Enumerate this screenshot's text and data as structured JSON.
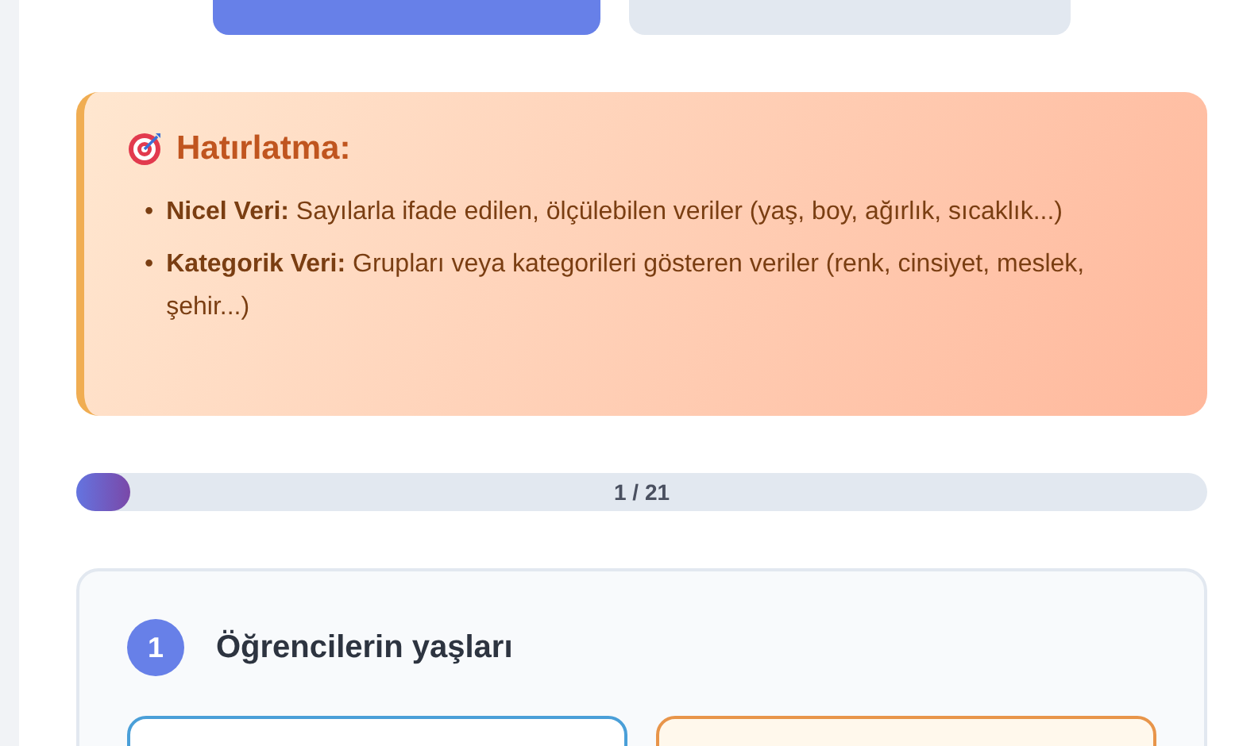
{
  "top_buttons": [
    {
      "selected": true
    },
    {
      "selected": false
    }
  ],
  "reminder": {
    "title": "Hatırlatma:",
    "items": [
      {
        "bullet": "•",
        "term": "Nicel Veri:",
        "text": "Sayılarla ifade edilen, ölçülebilen veriler (yaş, boy, ağırlık, sıcaklık...)"
      },
      {
        "bullet": "•",
        "term": "Kategorik Veri:",
        "text": "Grupları veya kategorileri gösteren veriler (renk, cinsiyet, meslek, şehir...)"
      }
    ]
  },
  "progress": {
    "level": 0.048,
    "label": "1 / 21"
  },
  "question": {
    "number": "1",
    "text": "Öğrencilerin yaşları",
    "options": [
      {
        "color": "#4a9fd8"
      },
      {
        "color": "#e8954a"
      }
    ]
  }
}
